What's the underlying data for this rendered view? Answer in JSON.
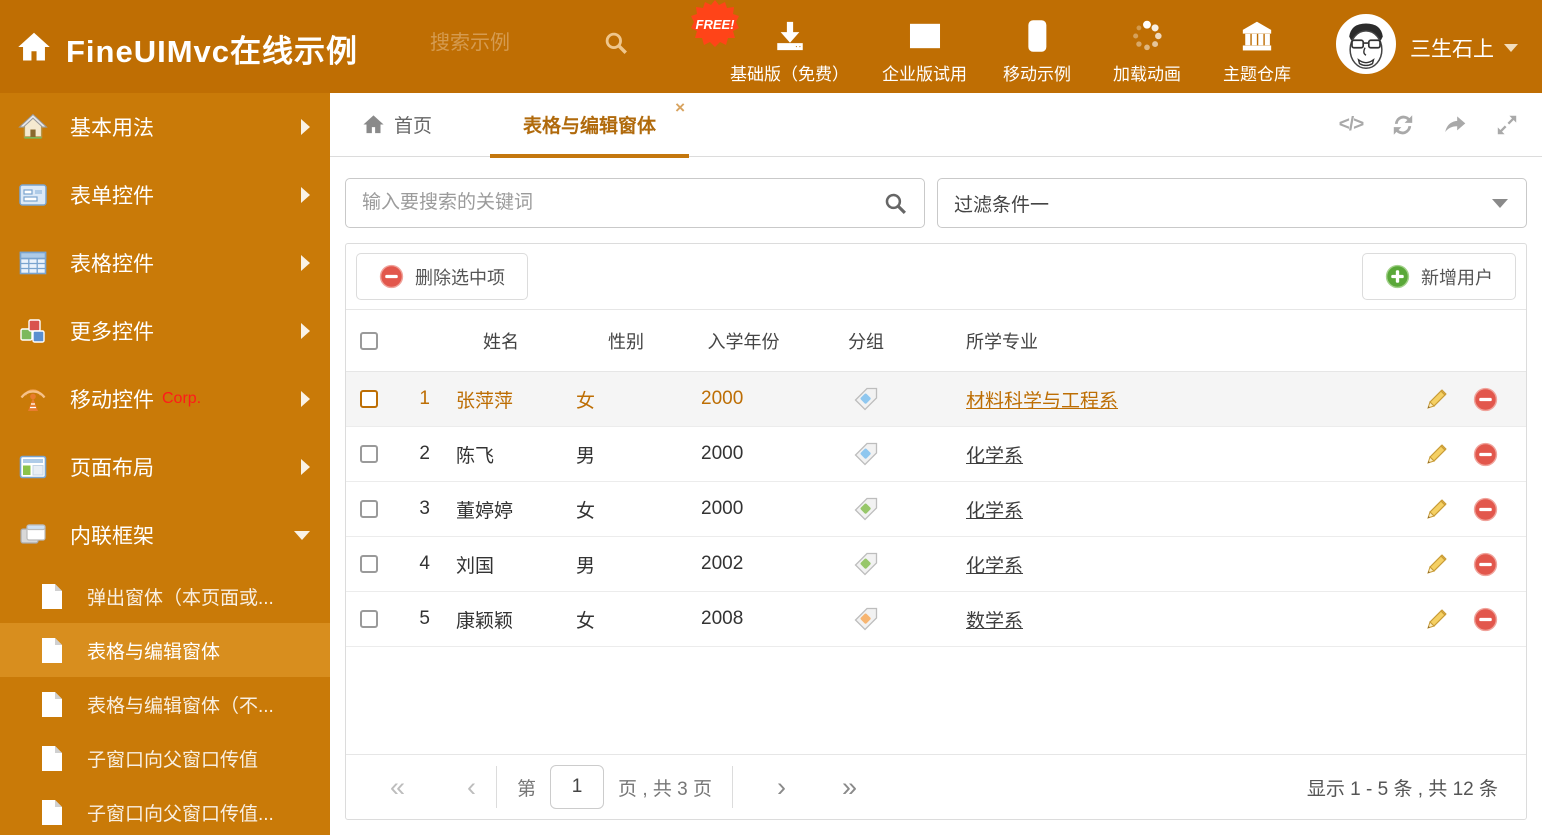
{
  "colors": {
    "header_bg": "#bf6e03",
    "sidebar_bg": "#c97a08",
    "sidebar_active_bg": "#d88e1e",
    "accent": "#bd6e04",
    "tab_underline": "#c4770e",
    "free_badge": "#ff4418",
    "delete_red": "#e2574c",
    "add_green": "#5aa839"
  },
  "header": {
    "logo_title": "FineUIMvc在线示例",
    "search_placeholder": "搜索示例",
    "free_badge": "FREE!",
    "nav": [
      {
        "icon": "download-icon",
        "label": "基础版（免费）"
      },
      {
        "icon": "envelope-icon",
        "label": "企业版试用"
      },
      {
        "icon": "mobile-icon",
        "label": "移动示例"
      },
      {
        "icon": "spinner-icon",
        "label": "加载动画"
      },
      {
        "icon": "bank-icon",
        "label": "主题仓库"
      }
    ],
    "user_name": "三生石上"
  },
  "sidebar": {
    "items": [
      {
        "icon": "home-icon",
        "label": "基本用法"
      },
      {
        "icon": "form-icon",
        "label": "表单控件"
      },
      {
        "icon": "table-icon",
        "label": "表格控件"
      },
      {
        "icon": "cubes-icon",
        "label": "更多控件"
      },
      {
        "icon": "antenna-icon",
        "label": "移动控件",
        "badge": "Corp."
      },
      {
        "icon": "layout-icon",
        "label": "页面布局"
      },
      {
        "icon": "frames-icon",
        "label": "内联框架",
        "expanded": true
      }
    ],
    "subitems": [
      {
        "label": "弹出窗体（本页面或..."
      },
      {
        "label": "表格与编辑窗体",
        "active": true
      },
      {
        "label": "表格与编辑窗体（不..."
      },
      {
        "label": "子窗口向父窗口传值"
      },
      {
        "label": "子窗口向父窗口传值..."
      }
    ]
  },
  "tabbar": {
    "home_tab": "首页",
    "active_tab": "表格与编辑窗体",
    "close_glyph": "×",
    "code_glyph": "</>"
  },
  "filters": {
    "search_placeholder": "输入要搜索的关键词",
    "filter_value": "过滤条件一"
  },
  "grid": {
    "delete_button": "删除选中项",
    "add_button": "新增用户",
    "columns": [
      "姓名",
      "性别",
      "入学年份",
      "分组",
      "所学专业"
    ],
    "rows": [
      {
        "num": "1",
        "name": "张萍萍",
        "gender": "女",
        "year": "2000",
        "tag_color": "#8fc7ef",
        "major": "材料科学与工程系",
        "selected": true
      },
      {
        "num": "2",
        "name": "陈飞",
        "gender": "男",
        "year": "2000",
        "tag_color": "#8fc7ef",
        "major": "化学系"
      },
      {
        "num": "3",
        "name": "董婷婷",
        "gender": "女",
        "year": "2000",
        "tag_color": "#97c76a",
        "major": "化学系"
      },
      {
        "num": "4",
        "name": "刘国",
        "gender": "男",
        "year": "2002",
        "tag_color": "#97c76a",
        "major": "化学系"
      },
      {
        "num": "5",
        "name": "康颖颖",
        "gender": "女",
        "year": "2008",
        "tag_color": "#f7b571",
        "major": "数学系"
      }
    ],
    "pager": {
      "first": "«",
      "prev": "‹",
      "label_prefix": "第",
      "page": "1",
      "label_suffix": "页 , 共 3 页",
      "next": "›",
      "last": "»",
      "summary": "显示 1 - 5 条 , 共 12 条"
    }
  }
}
